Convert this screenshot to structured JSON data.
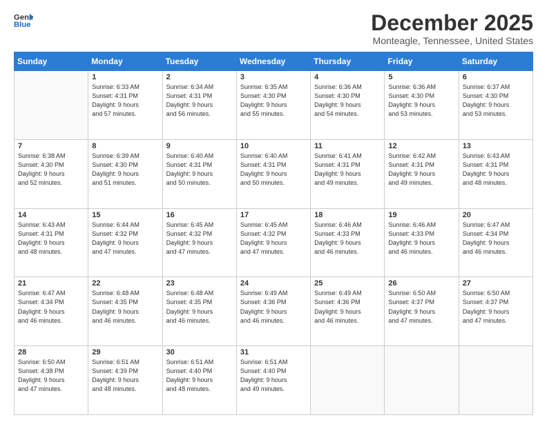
{
  "header": {
    "logo": {
      "line1": "General",
      "line2": "Blue"
    },
    "title": "December 2025",
    "subtitle": "Monteagle, Tennessee, United States"
  },
  "weekdays": [
    "Sunday",
    "Monday",
    "Tuesday",
    "Wednesday",
    "Thursday",
    "Friday",
    "Saturday"
  ],
  "weeks": [
    [
      {
        "day": "",
        "info": ""
      },
      {
        "day": "1",
        "info": "Sunrise: 6:33 AM\nSunset: 4:31 PM\nDaylight: 9 hours\nand 57 minutes."
      },
      {
        "day": "2",
        "info": "Sunrise: 6:34 AM\nSunset: 4:31 PM\nDaylight: 9 hours\nand 56 minutes."
      },
      {
        "day": "3",
        "info": "Sunrise: 6:35 AM\nSunset: 4:30 PM\nDaylight: 9 hours\nand 55 minutes."
      },
      {
        "day": "4",
        "info": "Sunrise: 6:36 AM\nSunset: 4:30 PM\nDaylight: 9 hours\nand 54 minutes."
      },
      {
        "day": "5",
        "info": "Sunrise: 6:36 AM\nSunset: 4:30 PM\nDaylight: 9 hours\nand 53 minutes."
      },
      {
        "day": "6",
        "info": "Sunrise: 6:37 AM\nSunset: 4:30 PM\nDaylight: 9 hours\nand 53 minutes."
      }
    ],
    [
      {
        "day": "7",
        "info": "Sunrise: 6:38 AM\nSunset: 4:30 PM\nDaylight: 9 hours\nand 52 minutes."
      },
      {
        "day": "8",
        "info": "Sunrise: 6:39 AM\nSunset: 4:30 PM\nDaylight: 9 hours\nand 51 minutes."
      },
      {
        "day": "9",
        "info": "Sunrise: 6:40 AM\nSunset: 4:31 PM\nDaylight: 9 hours\nand 50 minutes."
      },
      {
        "day": "10",
        "info": "Sunrise: 6:40 AM\nSunset: 4:31 PM\nDaylight: 9 hours\nand 50 minutes."
      },
      {
        "day": "11",
        "info": "Sunrise: 6:41 AM\nSunset: 4:31 PM\nDaylight: 9 hours\nand 49 minutes."
      },
      {
        "day": "12",
        "info": "Sunrise: 6:42 AM\nSunset: 4:31 PM\nDaylight: 9 hours\nand 49 minutes."
      },
      {
        "day": "13",
        "info": "Sunrise: 6:43 AM\nSunset: 4:31 PM\nDaylight: 9 hours\nand 48 minutes."
      }
    ],
    [
      {
        "day": "14",
        "info": "Sunrise: 6:43 AM\nSunset: 4:31 PM\nDaylight: 9 hours\nand 48 minutes."
      },
      {
        "day": "15",
        "info": "Sunrise: 6:44 AM\nSunset: 4:32 PM\nDaylight: 9 hours\nand 47 minutes."
      },
      {
        "day": "16",
        "info": "Sunrise: 6:45 AM\nSunset: 4:32 PM\nDaylight: 9 hours\nand 47 minutes."
      },
      {
        "day": "17",
        "info": "Sunrise: 6:45 AM\nSunset: 4:32 PM\nDaylight: 9 hours\nand 47 minutes."
      },
      {
        "day": "18",
        "info": "Sunrise: 6:46 AM\nSunset: 4:33 PM\nDaylight: 9 hours\nand 46 minutes."
      },
      {
        "day": "19",
        "info": "Sunrise: 6:46 AM\nSunset: 4:33 PM\nDaylight: 9 hours\nand 46 minutes."
      },
      {
        "day": "20",
        "info": "Sunrise: 6:47 AM\nSunset: 4:34 PM\nDaylight: 9 hours\nand 46 minutes."
      }
    ],
    [
      {
        "day": "21",
        "info": "Sunrise: 6:47 AM\nSunset: 4:34 PM\nDaylight: 9 hours\nand 46 minutes."
      },
      {
        "day": "22",
        "info": "Sunrise: 6:48 AM\nSunset: 4:35 PM\nDaylight: 9 hours\nand 46 minutes."
      },
      {
        "day": "23",
        "info": "Sunrise: 6:48 AM\nSunset: 4:35 PM\nDaylight: 9 hours\nand 46 minutes."
      },
      {
        "day": "24",
        "info": "Sunrise: 6:49 AM\nSunset: 4:36 PM\nDaylight: 9 hours\nand 46 minutes."
      },
      {
        "day": "25",
        "info": "Sunrise: 6:49 AM\nSunset: 4:36 PM\nDaylight: 9 hours\nand 46 minutes."
      },
      {
        "day": "26",
        "info": "Sunrise: 6:50 AM\nSunset: 4:37 PM\nDaylight: 9 hours\nand 47 minutes."
      },
      {
        "day": "27",
        "info": "Sunrise: 6:50 AM\nSunset: 4:37 PM\nDaylight: 9 hours\nand 47 minutes."
      }
    ],
    [
      {
        "day": "28",
        "info": "Sunrise: 6:50 AM\nSunset: 4:38 PM\nDaylight: 9 hours\nand 47 minutes."
      },
      {
        "day": "29",
        "info": "Sunrise: 6:51 AM\nSunset: 4:39 PM\nDaylight: 9 hours\nand 48 minutes."
      },
      {
        "day": "30",
        "info": "Sunrise: 6:51 AM\nSunset: 4:40 PM\nDaylight: 9 hours\nand 48 minutes."
      },
      {
        "day": "31",
        "info": "Sunrise: 6:51 AM\nSunset: 4:40 PM\nDaylight: 9 hours\nand 49 minutes."
      },
      {
        "day": "",
        "info": ""
      },
      {
        "day": "",
        "info": ""
      },
      {
        "day": "",
        "info": ""
      }
    ]
  ]
}
